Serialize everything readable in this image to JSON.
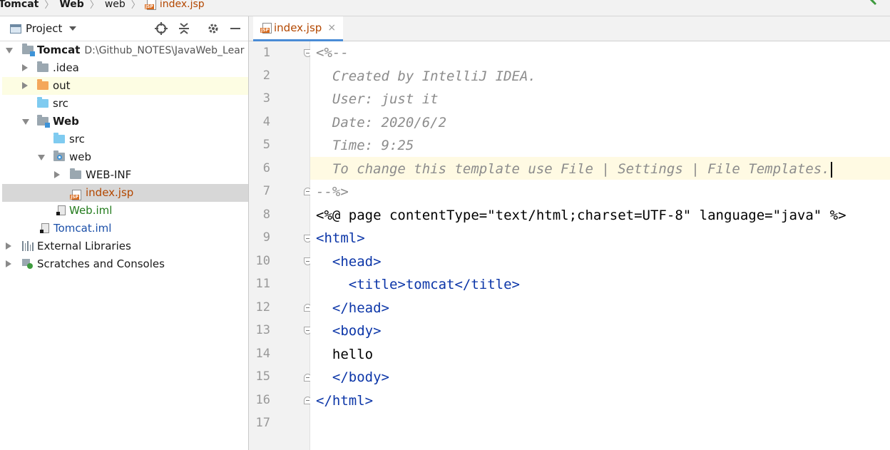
{
  "breadcrumb": {
    "items": [
      "Tomcat",
      "Web",
      "web",
      "index.jsp"
    ]
  },
  "project_panel": {
    "title": "Project",
    "tree": [
      {
        "label": "Tomcat",
        "path": "D:\\Github_NOTES\\JavaWeb_Lear"
      },
      {
        "label": ".idea"
      },
      {
        "label": "out"
      },
      {
        "label": "src"
      },
      {
        "label": "Web"
      },
      {
        "label": "src"
      },
      {
        "label": "web"
      },
      {
        "label": "WEB-INF"
      },
      {
        "label": "index.jsp"
      },
      {
        "label": "Web.iml"
      },
      {
        "label": "Tomcat.iml"
      },
      {
        "label": "External Libraries"
      },
      {
        "label": "Scratches and Consoles"
      }
    ]
  },
  "editor": {
    "tab_label": "index.jsp",
    "tab_close": "×",
    "line_numbers": [
      "1",
      "2",
      "3",
      "4",
      "5",
      "6",
      "7",
      "8",
      "9",
      "10",
      "11",
      "12",
      "13",
      "14",
      "15",
      "16",
      "17"
    ],
    "lines": [
      "<%--",
      "  Created by IntelliJ IDEA.",
      "  User: just it",
      "  Date: 2020/6/2",
      "  Time: 9:25",
      "  To change this template use File | Settings | File Templates.",
      "--%>",
      "<%@ page contentType=\"text/html;charset=UTF-8\" language=\"java\" %>",
      "<html>",
      "  <head>",
      "    <title>tomcat</title>",
      "  </head>",
      "  <body>",
      "  hello",
      "  </body>",
      "</html>",
      ""
    ]
  },
  "colors": {
    "accent": "#4a8cd6",
    "jsp_file": "#b34700",
    "comment": "#8c8c8c",
    "tag": "#0c36a8",
    "string": "#067d17",
    "attribute": "#174ad4"
  }
}
